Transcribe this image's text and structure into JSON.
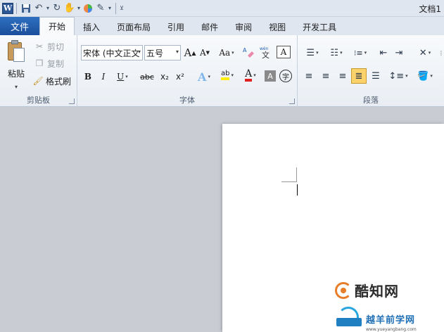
{
  "qat": {
    "app_icon_letter": "W",
    "save_icon": "save-icon",
    "undo_icon": "undo-icon",
    "redo_icon": "redo-icon",
    "doc_title": "文档1"
  },
  "tabs": {
    "file": "文件",
    "items": [
      "开始",
      "插入",
      "页面布局",
      "引用",
      "邮件",
      "审阅",
      "视图",
      "开发工具"
    ],
    "active_index": 0
  },
  "clipboard": {
    "paste": "粘贴",
    "cut": "剪切",
    "copy": "复制",
    "format_painter": "格式刷",
    "label": "剪贴板"
  },
  "font": {
    "font_name": "宋体 (中文正文",
    "font_size": "五号",
    "grow_font": "A",
    "shrink_font": "A",
    "change_case": "Aa",
    "bold": "B",
    "italic": "I",
    "underline": "U",
    "strikethrough": "abc",
    "subscript": "x₂",
    "superscript": "x²",
    "highlight": "ab",
    "font_color": "A",
    "char_shading": "A",
    "enclose": "字",
    "label": "字体"
  },
  "paragraph": {
    "label": "段落"
  },
  "watermark": {
    "brand1": "酷知网",
    "brand2": "越羊前学网",
    "url2": "www.yueyangbang.com"
  },
  "colors": {
    "file_tab": "#1a4f9c",
    "highlight_yellow": "#ffee00",
    "font_red": "#e02020",
    "active_align": "#fcd36a"
  }
}
